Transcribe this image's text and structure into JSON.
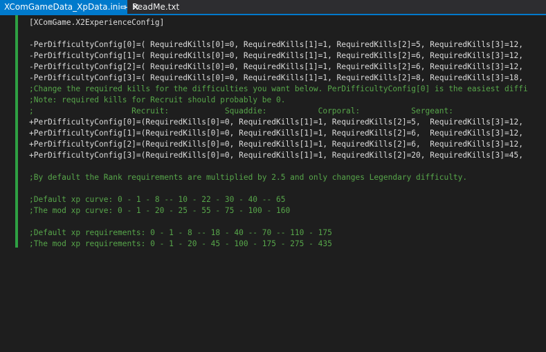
{
  "tabs": [
    {
      "label": "XComGameData_XpData.ini",
      "active": true,
      "icons": [
        "pin-icon",
        "close-icon"
      ]
    },
    {
      "label": "ReadMe.txt",
      "active": false
    }
  ],
  "colors": {
    "accent": "#007acc",
    "comment": "#57a64a",
    "text": "#dcdcdc",
    "background": "#1e1e1e",
    "change_bar": "#2ea043"
  },
  "lines": [
    {
      "text": "[XComGame.X2ExperienceConfig]",
      "kind": "section"
    },
    {
      "text": "",
      "kind": "blank"
    },
    {
      "text": "-PerDifficultyConfig[0]=( RequiredKills[0]=0, RequiredKills[1]=1, RequiredKills[2]=5, RequiredKills[3]=12, ",
      "kind": "key"
    },
    {
      "text": "-PerDifficultyConfig[1]=( RequiredKills[0]=0, RequiredKills[1]=1, RequiredKills[2]=6, RequiredKills[3]=12, ",
      "kind": "key"
    },
    {
      "text": "-PerDifficultyConfig[2]=( RequiredKills[0]=0, RequiredKills[1]=1, RequiredKills[2]=6, RequiredKills[3]=12, ",
      "kind": "key"
    },
    {
      "text": "-PerDifficultyConfig[3]=( RequiredKills[0]=0, RequiredKills[1]=1, RequiredKills[2]=8, RequiredKills[3]=18, ",
      "kind": "key"
    },
    {
      "text": ";Change the required kills for the difficulties you want below. PerDifficultyConfig[0] is the easiest diffi",
      "kind": "comment"
    },
    {
      "text": ";Note: required kills for Recruit should probably be 0.",
      "kind": "comment"
    },
    {
      "text": ";                     Recruit:            Squaddie:           Corporal:           Sergeant:",
      "kind": "comment"
    },
    {
      "text": "+PerDifficultyConfig[0]=(RequiredKills[0]=0, RequiredKills[1]=1, RequiredKills[2]=5,  RequiredKills[3]=12, ",
      "kind": "key"
    },
    {
      "text": "+PerDifficultyConfig[1]=(RequiredKills[0]=0, RequiredKills[1]=1, RequiredKills[2]=6,  RequiredKills[3]=12, ",
      "kind": "key"
    },
    {
      "text": "+PerDifficultyConfig[2]=(RequiredKills[0]=0, RequiredKills[1]=1, RequiredKills[2]=6,  RequiredKills[3]=12, ",
      "kind": "key"
    },
    {
      "text": "+PerDifficultyConfig[3]=(RequiredKills[0]=0, RequiredKills[1]=1, RequiredKills[2]=20, RequiredKills[3]=45, ",
      "kind": "key"
    },
    {
      "text": "",
      "kind": "blank"
    },
    {
      "text": ";By default the Rank requirements are multiplied by 2.5 and only changes Legendary difficulty.",
      "kind": "comment"
    },
    {
      "text": "",
      "kind": "blank"
    },
    {
      "text": ";Default xp curve: 0 - 1 - 8 -- 10 - 22 - 30 - 40 -- 65",
      "kind": "comment"
    },
    {
      "text": ";The mod xp curve: 0 - 1 - 20 - 25 - 55 - 75 - 100 - 160",
      "kind": "comment"
    },
    {
      "text": "",
      "kind": "blank"
    },
    {
      "text": ";Default xp requirements: 0 - 1 - 8 -- 18 - 40 -- 70 -- 110 - 175",
      "kind": "comment"
    },
    {
      "text": ";The mod xp requirements: 0 - 1 - 20 - 45 - 100 - 175 - 275 - 435",
      "kind": "comment"
    }
  ]
}
